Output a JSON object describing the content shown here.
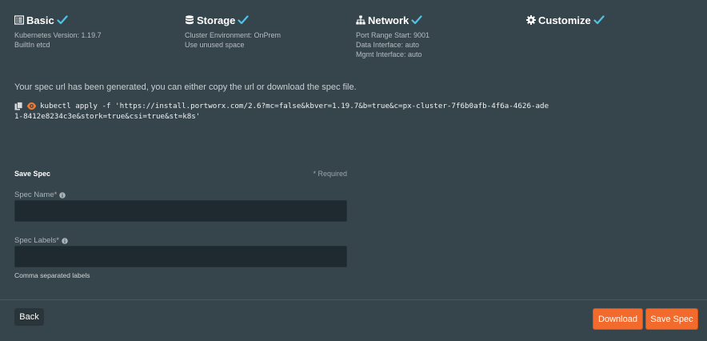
{
  "colors": {
    "background": "#36444b",
    "accent_check": "#4fc3e8",
    "primary_button": "#f26a2c",
    "input_bg": "#1e2a30",
    "eye_icon": "#f07a32"
  },
  "steps": [
    {
      "icon": "list-icon",
      "title": "Basic",
      "details": [
        "Kubernetes Version: 1.19.7",
        "BuiltIn etcd"
      ]
    },
    {
      "icon": "database-icon",
      "title": "Storage",
      "details": [
        "Cluster Environment: OnPrem",
        "Use unused space"
      ]
    },
    {
      "icon": "network-icon",
      "title": "Network",
      "details": [
        "Port Range Start: 9001",
        "Data Interface: auto",
        "Mgmt Interface: auto"
      ]
    },
    {
      "icon": "gear-icon",
      "title": "Customize",
      "details": []
    }
  ],
  "spec": {
    "message": "Your spec url has been generated, you can either copy the url or download the spec file.",
    "command": "kubectl apply -f 'https://install.portworx.com/2.6?mc=false&kbver=1.19.7&b=true&c=px-cluster-7f6b0afb-4f6a-4626-ade1-8412e8234c3e&stork=true&csi=true&st=k8s'"
  },
  "form": {
    "title": "Save Spec",
    "required_note": "* Required",
    "spec_name_label": "Spec Name*",
    "spec_name_value": "",
    "spec_labels_label": "Spec Labels*",
    "spec_labels_value": "",
    "labels_hint": "Comma separated labels"
  },
  "footer": {
    "back_label": "Back",
    "download_label": "Download",
    "save_label": "Save Spec"
  }
}
